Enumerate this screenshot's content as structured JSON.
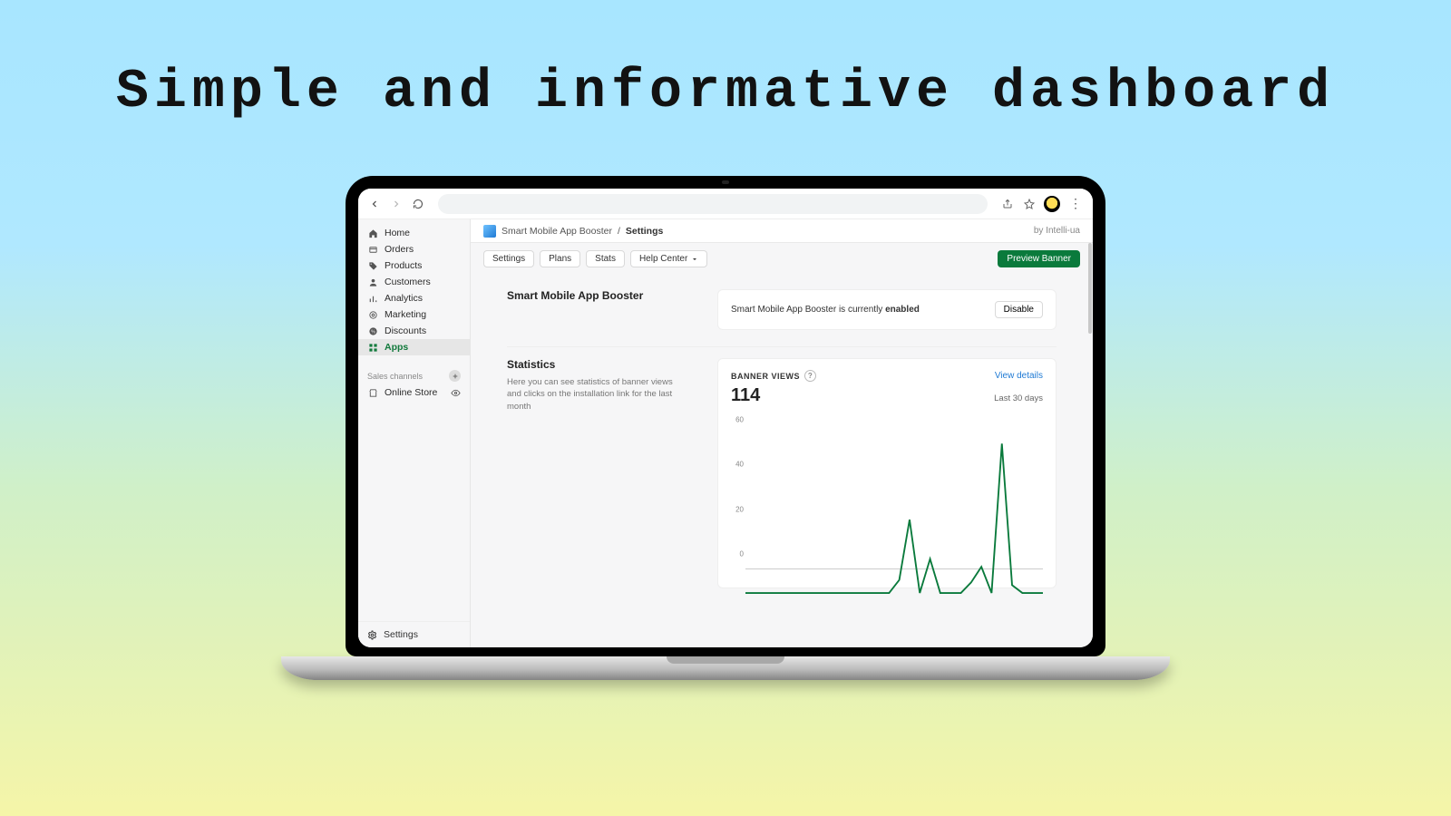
{
  "hero": {
    "title": "Simple and informative dashboard"
  },
  "sidebar": {
    "items": [
      {
        "label": "Home"
      },
      {
        "label": "Orders"
      },
      {
        "label": "Products"
      },
      {
        "label": "Customers"
      },
      {
        "label": "Analytics"
      },
      {
        "label": "Marketing"
      },
      {
        "label": "Discounts"
      },
      {
        "label": "Apps"
      }
    ],
    "channels_label": "Sales channels",
    "channels": [
      {
        "label": "Online Store"
      }
    ],
    "footer": {
      "label": "Settings"
    }
  },
  "breadcrumb": {
    "app": "Smart Mobile App Booster",
    "sep": "/",
    "page": "Settings",
    "author": "by Intelli-ua"
  },
  "toolbar": {
    "settings": "Settings",
    "plans": "Plans",
    "stats": "Stats",
    "help": "Help Center",
    "preview": "Preview Banner"
  },
  "section_app": {
    "title": "Smart Mobile App Booster"
  },
  "status": {
    "prefix": "Smart Mobile App Booster is currently ",
    "state": "enabled",
    "disable": "Disable"
  },
  "stats": {
    "title": "Statistics",
    "desc": "Here you can see statistics of banner views and clicks on the installation link for the last month",
    "metric_label": "BANNER VIEWS",
    "view_details": "View details",
    "value": "114",
    "period": "Last 30 days"
  },
  "chart_data": {
    "type": "line",
    "title": "Banner Views",
    "xlabel": "",
    "ylabel": "",
    "ylim": [
      0,
      60
    ],
    "y_ticks": [
      0,
      20,
      40,
      60
    ],
    "x": [
      1,
      2,
      3,
      4,
      5,
      6,
      7,
      8,
      9,
      10,
      11,
      12,
      13,
      14,
      15,
      16,
      17,
      18,
      19,
      20,
      21,
      22,
      23,
      24,
      25,
      26,
      27,
      28,
      29,
      30
    ],
    "values": [
      0,
      0,
      0,
      0,
      0,
      0,
      0,
      0,
      0,
      0,
      0,
      0,
      0,
      0,
      0,
      5,
      28,
      0,
      13,
      0,
      0,
      0,
      4,
      10,
      0,
      57,
      3,
      0,
      0,
      0
    ]
  }
}
